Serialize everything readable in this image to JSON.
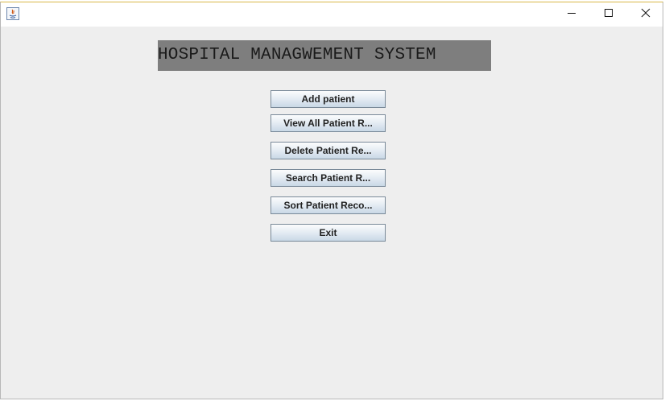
{
  "window": {
    "title": "",
    "controls": {
      "minimize_icon": "minimize-icon",
      "maximize_icon": "maximize-icon",
      "close_icon": "close-icon"
    }
  },
  "main": {
    "heading": "HOSPITAL MANAGWEMENT SYSTEM",
    "buttons": [
      {
        "label": "Add patient"
      },
      {
        "label": "View All Patient R..."
      },
      {
        "label": "Delete Patient Re..."
      },
      {
        "label": "Search Patient R..."
      },
      {
        "label": "Sort Patient Reco..."
      },
      {
        "label": "Exit"
      }
    ]
  },
  "colors": {
    "window_bg": "#eeeeee",
    "heading_bg": "#7e7e7e",
    "button_border": "#7a8a99"
  }
}
